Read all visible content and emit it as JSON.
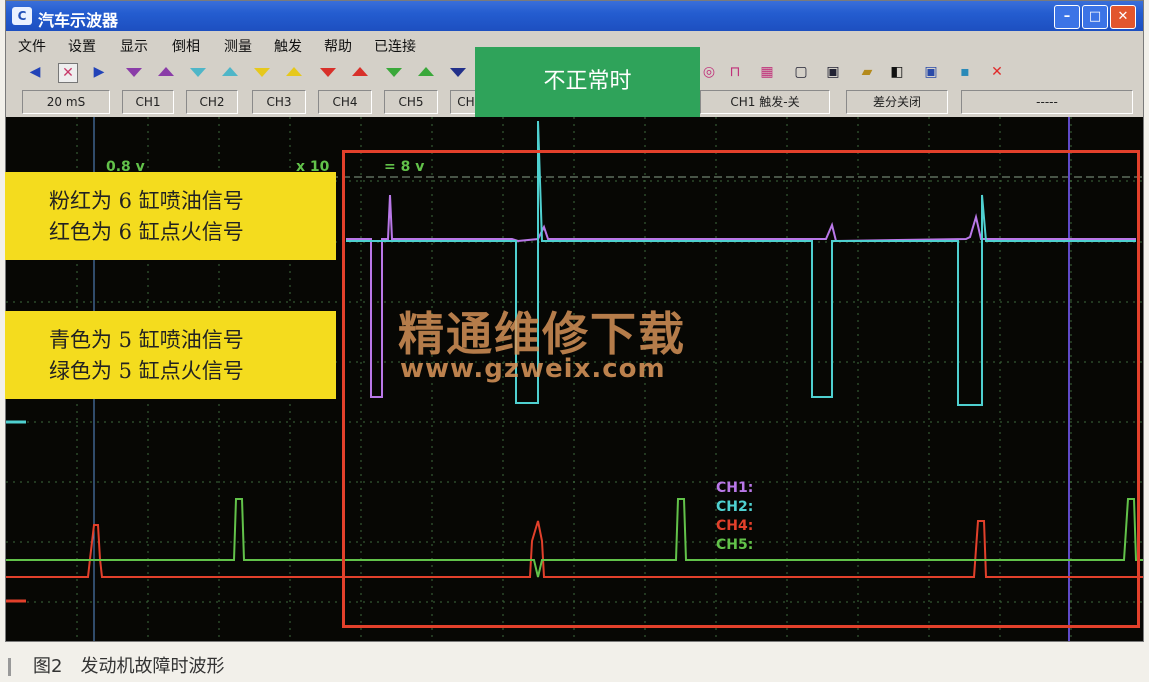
{
  "window": {
    "title": "汽车示波器",
    "logo_text": "C"
  },
  "menu": [
    "文件",
    "设置",
    "显示",
    "倒相",
    "测量",
    "触发",
    "帮助",
    "已连接"
  ],
  "status": {
    "timebase": "20 mS",
    "channels": [
      "CH1",
      "CH2",
      "CH3",
      "CH4",
      "CH5",
      "CH"
    ],
    "trigger": "CH1  触发-关",
    "diff": "差分关闭",
    "extra": "-----"
  },
  "scope": {
    "scale_left": "0.8 v",
    "scale_mid": "x 10",
    "scale_right": "= 8 v",
    "channel_labels": [
      "CH1:",
      "CH2:",
      "CH4:",
      "CH5:"
    ],
    "colors": {
      "CH1": "#b978e8",
      "CH2": "#4fd0d0",
      "CH4": "#e2402b",
      "CH5": "#62c24a",
      "background": "#070704"
    }
  },
  "banner": "不正常时",
  "notes": {
    "note1_line1": "粉红为 6 缸喷油信号",
    "note1_line2": "红色为 6 缸点火信号",
    "note2_line1": "青色为 5 缸喷油信号",
    "note2_line2": "绿色为 5 缸点火信号"
  },
  "watermark": {
    "cn": "精通维修下载",
    "url": "www.gzweix.com"
  },
  "caption": "图2　发动机故障时波形"
}
